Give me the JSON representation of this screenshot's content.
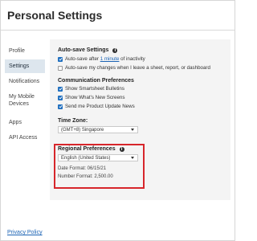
{
  "header": {
    "title": "Personal Settings"
  },
  "sidebar": {
    "items": [
      {
        "label": "Profile",
        "active": false
      },
      {
        "label": "Settings",
        "active": true
      },
      {
        "label": "Notifications",
        "active": false
      },
      {
        "label": "My Mobile Devices",
        "active": false
      },
      {
        "label": "Apps",
        "active": false
      },
      {
        "label": "API Access",
        "active": false
      }
    ]
  },
  "autosave": {
    "heading": "Auto-save Settings",
    "option1_prefix": "Auto-save after ",
    "option1_link": "1 minute",
    "option1_suffix": " of inactivity",
    "option1_checked": true,
    "option2_label": "Auto-save my changes when I leave a sheet, report, or dashboard",
    "option2_checked": false
  },
  "communication": {
    "heading": "Communication Preferences",
    "options": [
      {
        "label": "Show Smartsheet Bulletins",
        "checked": true
      },
      {
        "label": "Show What's New Screens",
        "checked": true
      },
      {
        "label": "Send me Product Update News",
        "checked": true
      }
    ]
  },
  "timezone": {
    "heading": "Time Zone:",
    "selected": "(GMT+8) Singapore"
  },
  "regional": {
    "heading": "Regional Preferences",
    "selected": "English (United States)",
    "date_format": "Date Format: 06/15/21",
    "number_format": "Number Format: 2,500.00"
  },
  "footer": {
    "privacy_link": "Privacy Policy"
  },
  "colors": {
    "accent": "#1f6fbf",
    "highlight": "#d7262b",
    "active_nav": "#dde6ee",
    "panel": "#f4f4f4"
  }
}
